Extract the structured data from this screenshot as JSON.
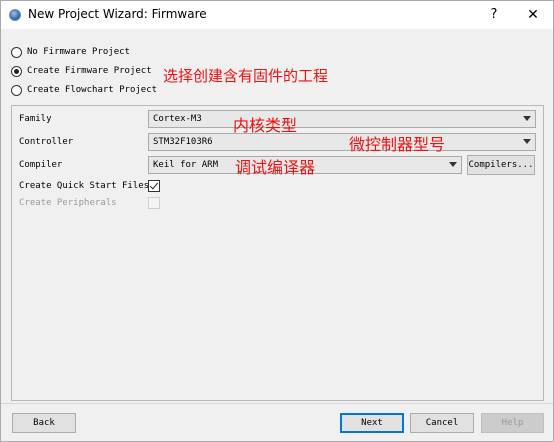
{
  "window": {
    "title": "New Project Wizard: Firmware",
    "help_label": "?",
    "close_label": "✕"
  },
  "project_type": {
    "options": [
      {
        "label": "No Firmware Project",
        "selected": false
      },
      {
        "label": "Create Firmware Project",
        "selected": true
      },
      {
        "label": "Create Flowchart Project",
        "selected": false
      }
    ]
  },
  "annotations": {
    "create_firmware": "选择创建含有固件的工程",
    "core_type": "内核类型",
    "controller_model": "微控制器型号",
    "compiler": "调试编译器"
  },
  "form": {
    "family_label": "Family",
    "family_value": "Cortex-M3",
    "controller_label": "Controller",
    "controller_value": "STM32F103R6",
    "compiler_label": "Compiler",
    "compiler_value": "Keil for ARM",
    "compilers_button": "Compilers...",
    "quick_start_label": "Create Quick Start Files",
    "quick_start_checked": true,
    "peripherals_label": "Create Peripherals",
    "peripherals_enabled": false
  },
  "footer": {
    "back": "Back",
    "next": "Next",
    "cancel": "Cancel",
    "help": "Help"
  },
  "colors": {
    "annotation": "#ee1111",
    "default_button_border": "#0078d7"
  }
}
